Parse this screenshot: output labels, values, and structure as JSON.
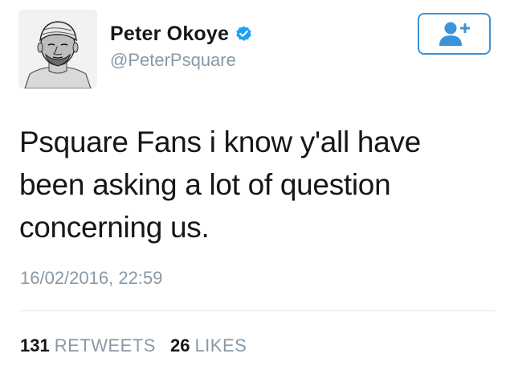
{
  "user": {
    "display_name": "Peter Okoye",
    "handle": "@PeterPsquare",
    "verified": true
  },
  "follow_button": {
    "icon": "add-user-icon"
  },
  "tweet": {
    "text": "Psquare Fans i know y'all have been asking a lot of question concerning us.",
    "timestamp": "16/02/2016, 22:59"
  },
  "stats": {
    "retweets_count": "131",
    "retweets_label": "RETWEETS",
    "likes_count": "26",
    "likes_label": "LIKES"
  },
  "colors": {
    "accent": "#3b94d9",
    "verified_badge": "#1da1f2",
    "secondary_text": "#8899a6",
    "primary_text": "#14171a",
    "divider": "#e1e8ed"
  }
}
